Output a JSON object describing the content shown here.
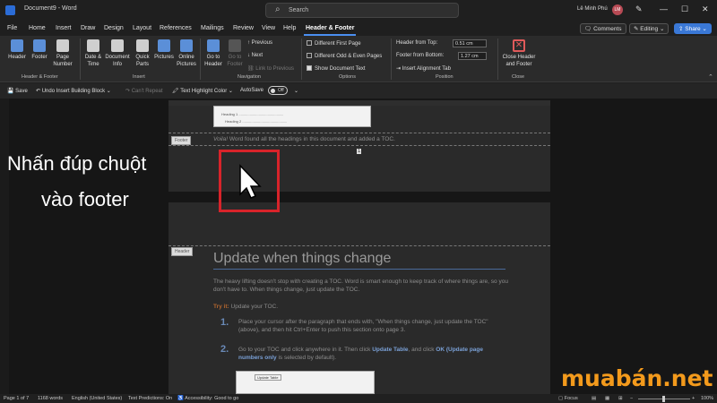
{
  "titlebar": {
    "doc_name": "Document9  -  Word",
    "search_placeholder": "Search",
    "user_name": "Lê Minh Phú",
    "avatar_initials": "LM"
  },
  "menu": {
    "tabs": [
      "File",
      "Home",
      "Insert",
      "Draw",
      "Design",
      "Layout",
      "References",
      "Mailings",
      "Review",
      "View",
      "Help",
      "Header & Footer"
    ],
    "active_tab": "Header & Footer",
    "comments": "Comments",
    "editing": "Editing",
    "share": "Share"
  },
  "ribbon": {
    "header": "Header",
    "footer": "Footer",
    "page_number": "Page Number",
    "group_hf": "Header & Footer",
    "date_time": "Date & Time",
    "document_info": "Document Info",
    "quick_parts": "Quick Parts",
    "pictures": "Pictures",
    "online_pictures": "Online Pictures",
    "group_insert": "Insert",
    "go_to_header": "Go to Header",
    "go_to_footer": "Go to Footer",
    "previous": "Previous",
    "next": "Next",
    "link_to_previous": "Link to Previous",
    "group_navigation": "Navigation",
    "different_first_page": "Different First Page",
    "different_odd_even": "Different Odd & Even Pages",
    "show_document_text": "Show Document Text",
    "group_options": "Options",
    "header_from_top_label": "Header from Top:",
    "header_from_top_value": "0.51 cm",
    "footer_from_bottom_label": "Footer from Bottom:",
    "footer_from_bottom_value": "1.27 cm",
    "insert_alignment_tab": "Insert Alignment Tab",
    "group_position": "Position",
    "close_header_footer": "Close Header and Footer",
    "group_close": "Close"
  },
  "qat": {
    "save": "Save",
    "undo": "Undo Insert Building Block",
    "repeat": "Can't Repeat",
    "highlight": "Text Highlight Color",
    "autosave": "AutoSave",
    "autosave_state": "Off"
  },
  "document": {
    "toc_line1": "Heading 1 .............................................",
    "toc_line2": "Heading 2 .............................................",
    "footer_tag": "Footer",
    "header_tag": "Header",
    "voila_em": "Voila!",
    "voila_text": "Word found all the headings in this document and added a TOC.",
    "page_number": "1",
    "heading": "Update when things change",
    "para": "The heavy lifting doesn't stop with creating a TOC. Word is smart enough to keep track of where things are, so you don't have to. When things change, just update the TOC.",
    "tryit_label": "Try it:",
    "tryit_text": "Update your TOC.",
    "step1_num": "1.",
    "step1": "Place your cursor after the paragraph that ends with, \"When things change, just update the TOC\" (above), and then hit Ctrl+Enter to push this section onto page 3.",
    "step2_num": "2.",
    "step2_a": "Go to your TOC and click anywhere in it. Then click",
    "step2_b": "Update Table",
    "step2_c": ", and click",
    "step2_d": "OK (Update page numbers only",
    "step2_e": "is selected by default).",
    "thumb_text": "Update Table"
  },
  "overlay": {
    "line1": "Nhấn đúp chuột",
    "line2": "vào footer"
  },
  "watermark": "muabán.net",
  "status": {
    "page": "Page 1 of 7",
    "words": "1168 words",
    "language": "English (United States)",
    "predictions": "Text Predictions: On",
    "accessibility": "Accessibility: Good to go",
    "focus": "Focus",
    "zoom": "100%"
  },
  "colors": {
    "accent": "#4a8ef0",
    "highlight_box": "#d8232a",
    "watermark": "#f39a1c"
  }
}
